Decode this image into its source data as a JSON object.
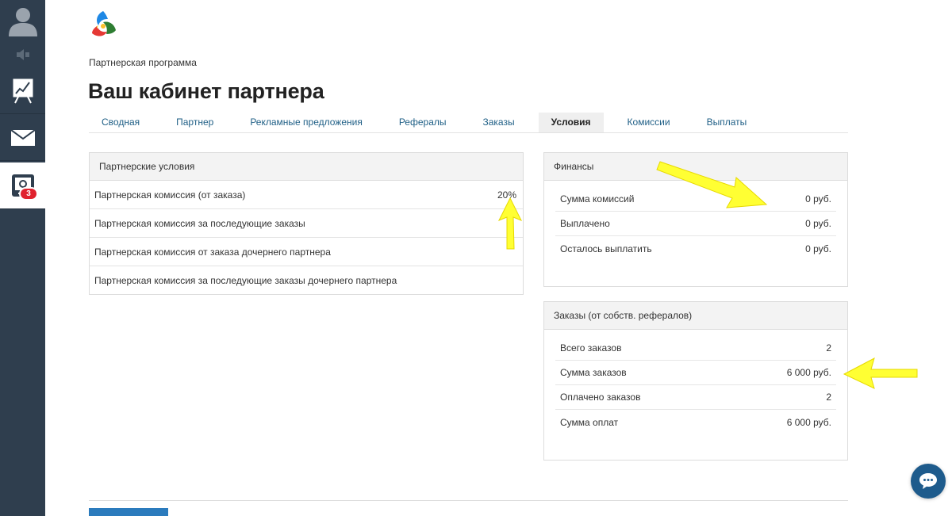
{
  "sidebar": {
    "badge_count": "3"
  },
  "breadcrumb": "Партнерская программа",
  "page_title": "Ваш кабинет партнера",
  "tabs": [
    {
      "label": "Сводная",
      "active": false
    },
    {
      "label": "Партнер",
      "active": false
    },
    {
      "label": "Рекламные предложения",
      "active": false
    },
    {
      "label": "Рефералы",
      "active": false
    },
    {
      "label": "Заказы",
      "active": false
    },
    {
      "label": "Условия",
      "active": true
    },
    {
      "label": "Комиссии",
      "active": false
    },
    {
      "label": "Выплаты",
      "active": false
    }
  ],
  "terms": {
    "title": "Партнерские условия",
    "rows": [
      {
        "label": "Партнерская комиссия (от заказа)",
        "value": "20%"
      },
      {
        "label": "Партнерская комиссия за последующие заказы",
        "value": ""
      },
      {
        "label": "Партнерская комиссия от заказа дочернего партнера",
        "value": ""
      },
      {
        "label": "Партнерская комиссия за последующие заказы дочернего партнера",
        "value": ""
      }
    ]
  },
  "finance": {
    "title": "Финансы",
    "rows": [
      {
        "label": "Сумма комиссий",
        "value": "0 руб."
      },
      {
        "label": "Выплачено",
        "value": "0 руб."
      },
      {
        "label": "Осталось выплатить",
        "value": "0 руб."
      }
    ]
  },
  "orders": {
    "title": "Заказы (от собств. рефералов)",
    "rows": [
      {
        "label": "Всего заказов",
        "value": "2"
      },
      {
        "label": "Сумма заказов",
        "value": "6 000 руб."
      },
      {
        "label": "Оплачено заказов",
        "value": "2"
      },
      {
        "label": "Сумма оплат",
        "value": "6 000 руб."
      }
    ]
  },
  "colors": {
    "sidebar": "#2f3e4e",
    "link": "#1f5f86",
    "badge": "#e0222e",
    "annotation_arrow": "#ffff33",
    "chat_button": "#1e5b8c"
  },
  "icons": [
    "user-avatar-icon",
    "speaker-icon",
    "chart-board-icon",
    "mail-icon",
    "partner-settings-icon",
    "chat-bubble-icon"
  ]
}
